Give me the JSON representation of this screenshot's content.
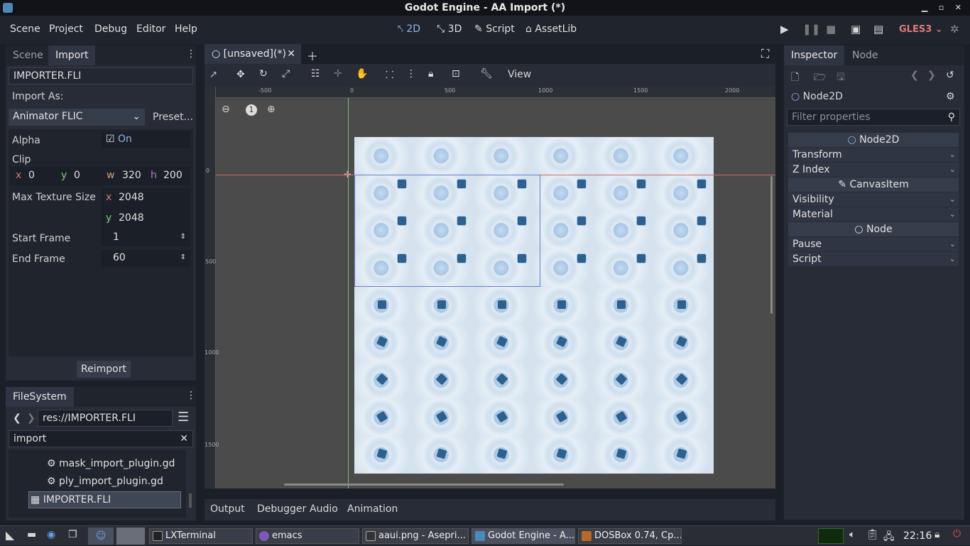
{
  "window": {
    "title": "Godot Engine - AA Import (*)",
    "controls": "▁ ▫ ✕"
  },
  "menu": [
    "Scene",
    "Project",
    "Debug",
    "Editor",
    "Help"
  ],
  "workspaces": [
    {
      "icon": "2d-icon",
      "label": "2D",
      "active": true
    },
    {
      "icon": "3d-icon",
      "label": "3D"
    },
    {
      "icon": "script-icon",
      "label": "Script"
    },
    {
      "icon": "assetlib-icon",
      "label": "AssetLib"
    }
  ],
  "renderer": "GLES3",
  "left_dock": {
    "tabs": [
      "Scene",
      "Import"
    ],
    "file": "IMPORTER.FLI",
    "import_as_label": "Import As:",
    "importer": "Animator FLIC",
    "preset": "Preset...",
    "alpha_label": "Alpha",
    "alpha_value": "On",
    "clip_label": "Clip",
    "clip": {
      "x": "0",
      "y": "0",
      "w": "320",
      "h": "200"
    },
    "max_texture_label": "Max Texture Size",
    "max_texture": {
      "x": "2048",
      "y": "2048"
    },
    "start_frame_label": "Start Frame",
    "start_frame": "1",
    "end_frame_label": "End Frame",
    "end_frame": "60",
    "reimport": "Reimport"
  },
  "filesystem": {
    "tab": "FileSystem",
    "path": "res://IMPORTER.FLI",
    "filter": "import",
    "items": [
      "mask_import_plugin.gd",
      "ply_import_plugin.gd",
      "IMPORTER.FLI"
    ]
  },
  "editor": {
    "tab": "[unsaved](*)",
    "view_menu": "View",
    "zoom_reset": "1",
    "ruler_h": [
      "-500",
      "0",
      "500",
      "1000",
      "1500",
      "2000"
    ],
    "ruler_v": [
      "0",
      "500",
      "1000",
      "1500"
    ]
  },
  "bottom_tabs": [
    "Output",
    "Debugger",
    "Audio",
    "Animation"
  ],
  "inspector": {
    "tabs": [
      "Inspector",
      "Node"
    ],
    "node": "Node2D",
    "filter_placeholder": "Filter properties",
    "sections": [
      {
        "type": "header",
        "label": "Node2D"
      },
      {
        "type": "row",
        "label": "Transform"
      },
      {
        "type": "row",
        "label": "Z Index"
      },
      {
        "type": "header",
        "label": "CanvasItem"
      },
      {
        "type": "row",
        "label": "Visibility"
      },
      {
        "type": "row",
        "label": "Material"
      },
      {
        "type": "header",
        "label": "Node"
      },
      {
        "type": "row",
        "label": "Pause"
      },
      {
        "type": "row",
        "label": "Script"
      }
    ]
  },
  "taskbar": {
    "tasks": [
      "LXTerminal",
      "emacs",
      "aaui.png - Asepri...",
      "Godot Engine - A...",
      "DOSBox 0.74, Cp..."
    ],
    "clock": "22:16"
  }
}
